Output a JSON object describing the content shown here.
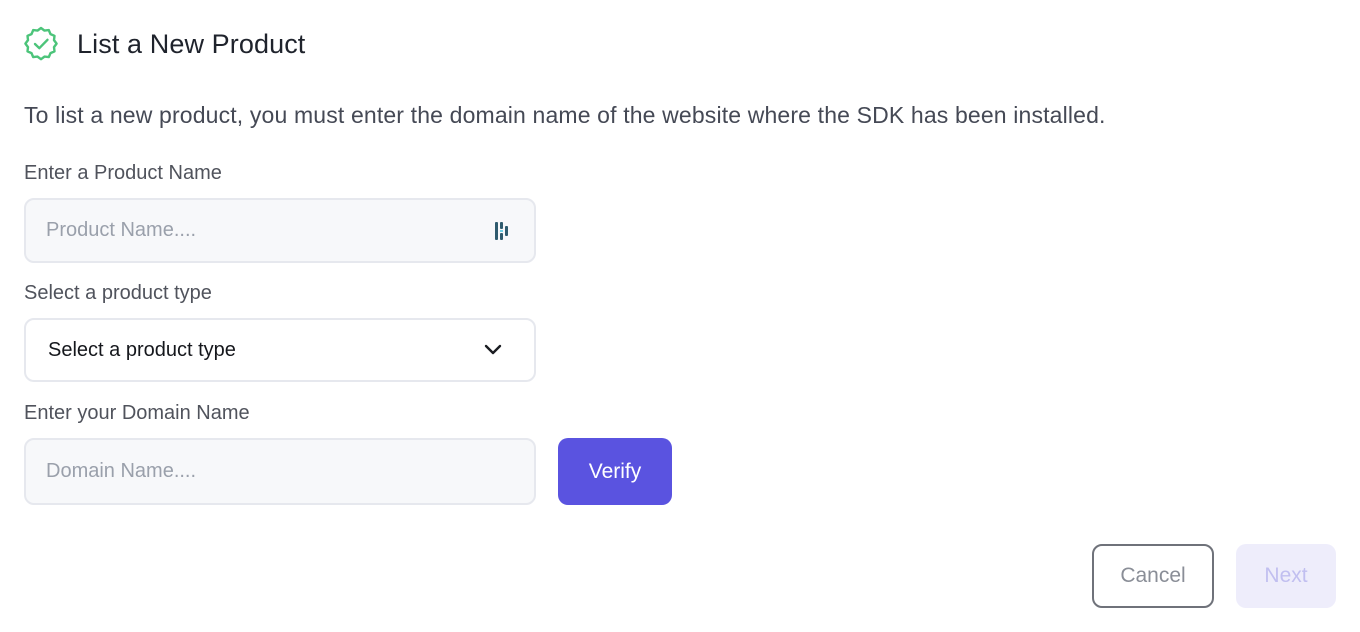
{
  "header": {
    "title": "List a New Product",
    "icon": "verified-badge-icon",
    "icon_color": "#4cc47a"
  },
  "description": "To list a new product, you must enter the domain name of the website where the SDK has been installed.",
  "form": {
    "product_name": {
      "label": "Enter a Product Name",
      "placeholder": "Product Name....",
      "value": "",
      "trailing_icon": "password-manager-icon"
    },
    "product_type": {
      "label": "Select a product type",
      "selected": "Select a product type",
      "icon": "chevron-down-icon"
    },
    "domain_name": {
      "label": "Enter your Domain Name",
      "placeholder": "Domain Name....",
      "value": ""
    },
    "verify_label": "Verify"
  },
  "actions": {
    "cancel_label": "Cancel",
    "next_label": "Next",
    "next_disabled": true
  },
  "colors": {
    "accent": "#5a53e0",
    "next_disabled_bg": "#eeedfb",
    "next_disabled_text": "#c1bff0"
  }
}
